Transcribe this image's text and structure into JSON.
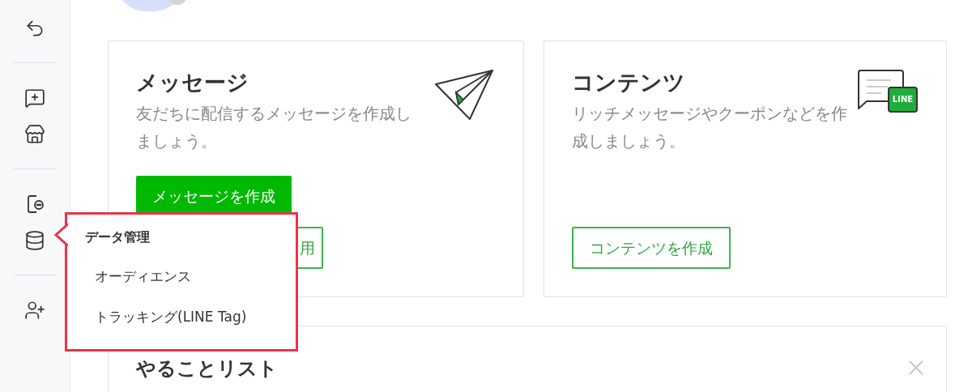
{
  "sidebar": {
    "groups": [
      {
        "items": [
          {
            "kind": "reply"
          }
        ]
      },
      {
        "items": [
          {
            "kind": "message-add"
          },
          {
            "kind": "shop"
          }
        ]
      },
      {
        "items": [
          {
            "kind": "phone-chat"
          },
          {
            "kind": "database"
          }
        ]
      },
      {
        "items": [
          {
            "kind": "user-add"
          }
        ]
      }
    ]
  },
  "cards": [
    {
      "title": "メッセージ",
      "description": "友だちに配信するメッセージを作成しましょう。",
      "kind": "paper-plane",
      "buttons": [
        {
          "label": "メッセージを作成",
          "kind": "primary"
        },
        {
          "label": "用",
          "kind": "outline-covered"
        }
      ]
    },
    {
      "title": "コンテンツ",
      "description": "リッチメッセージやクーポンなどを作成しましょう。",
      "kind": "chat-bubble",
      "badge": "LINE",
      "buttons": [
        {
          "label": "コンテンツを作成",
          "kind": "outline"
        }
      ]
    }
  ],
  "todo": {
    "title": "やることリスト"
  },
  "popup": {
    "title": "データ管理",
    "items": [
      "オーディエンス",
      "トラッキング(LINE Tag)"
    ]
  }
}
